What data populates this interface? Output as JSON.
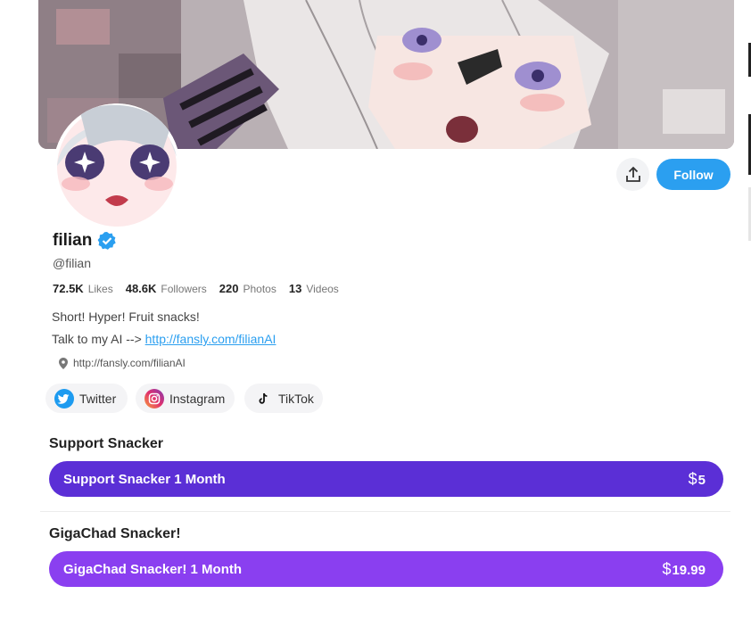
{
  "profile": {
    "display_name": "filian",
    "handle": "@filian",
    "stats": [
      {
        "value": "72.5K",
        "label": "Likes"
      },
      {
        "value": "48.6K",
        "label": "Followers"
      },
      {
        "value": "220",
        "label": "Photos"
      },
      {
        "value": "13",
        "label": "Videos"
      }
    ],
    "bio_line1": "Short! Hyper! Fruit snacks!",
    "bio_line2_prefix": "Talk to my AI -->",
    "bio_link": "http://fansly.com/filianAI",
    "location": "http://fansly.com/filianAI"
  },
  "actions": {
    "follow_label": "Follow",
    "share_icon": "share-icon"
  },
  "socials": [
    {
      "label": "Twitter",
      "icon": "twitter-icon"
    },
    {
      "label": "Instagram",
      "icon": "instagram-icon"
    },
    {
      "label": "TikTok",
      "icon": "tiktok-icon"
    }
  ],
  "tiers": [
    {
      "title": "Support Snacker",
      "button_label": "Support Snacker 1 Month",
      "currency": "$",
      "price": "5",
      "color": "#5b2fd6"
    },
    {
      "title": "GigaChad Snacker!",
      "button_label": "GigaChad Snacker! 1 Month",
      "currency": "$",
      "price": "19.99",
      "color": "#8a3ff0"
    }
  ],
  "colors": {
    "accent": "#2b9ff0",
    "verified": "#2b9ff0"
  }
}
